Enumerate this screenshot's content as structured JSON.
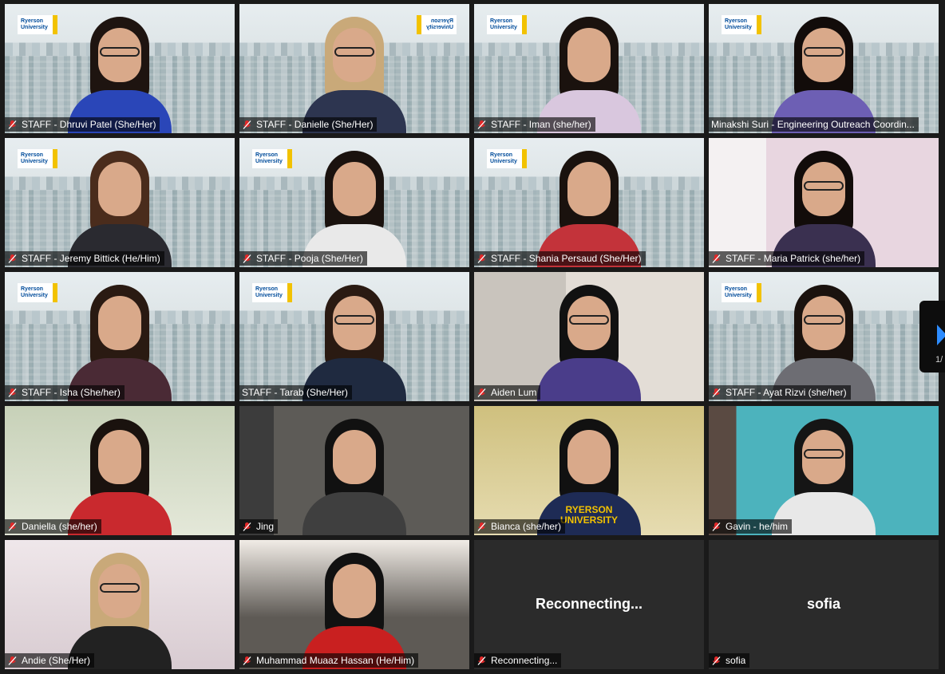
{
  "colors": {
    "active_speaker_border": "#c8e05a",
    "name_plate_bg": "rgba(0,0,0,0.62)",
    "muted_mic": "#e02828",
    "pager_arrow": "#2d8cff"
  },
  "pager": {
    "count": "1/"
  },
  "tiles": [
    {
      "name": "STAFF - Dhruvi Patel (She/Her)",
      "muted": true,
      "video": true,
      "bg": "city",
      "logo": "Ryerson University"
    },
    {
      "name": "STAFF - Danielle (She/Her)",
      "muted": true,
      "video": true,
      "bg": "city",
      "logo": "Ryerson University",
      "logo_mirrored": true
    },
    {
      "name": "STAFF - Iman (she/her)",
      "muted": true,
      "video": true,
      "bg": "city",
      "logo": "Ryerson University"
    },
    {
      "name": "Minakshi Suri - Engineering Outreach Coordin...",
      "muted": false,
      "video": true,
      "bg": "city",
      "logo": "Ryerson University",
      "active": true
    },
    {
      "name": "STAFF - Jeremy Bittick (He/Him)",
      "muted": true,
      "video": true,
      "bg": "city",
      "logo": "Ryerson University"
    },
    {
      "name": "STAFF - Pooja (She/Her)",
      "muted": true,
      "video": true,
      "bg": "city",
      "logo": "Ryerson University"
    },
    {
      "name": "STAFF - Shania Persaud (She/Her)",
      "muted": true,
      "video": true,
      "bg": "city",
      "logo": "Ryerson University"
    },
    {
      "name": "STAFF - Maria Patrick (she/her)",
      "muted": true,
      "video": true,
      "bg": "pink"
    },
    {
      "name": "STAFF - Isha (She/her)",
      "muted": true,
      "video": true,
      "bg": "city",
      "logo": "Ryerson University"
    },
    {
      "name": "STAFF - Tarab (She/Her)",
      "muted": false,
      "video": true,
      "bg": "city",
      "logo": "Ryerson University"
    },
    {
      "name": "Aiden Lum",
      "muted": true,
      "video": true,
      "bg": "shelf"
    },
    {
      "name": "STAFF - Ayat Rizvi (she/her)",
      "muted": true,
      "video": true,
      "bg": "city",
      "logo": "Ryerson University"
    },
    {
      "name": "Daniella (she/her)",
      "muted": true,
      "video": true,
      "bg": "green"
    },
    {
      "name": "Jing",
      "muted": true,
      "video": true,
      "bg": "grey"
    },
    {
      "name": "Bianca (she/her)",
      "muted": true,
      "video": true,
      "bg": "yellow",
      "shirt_text": "RYERSON UNIVERSITY"
    },
    {
      "name": "Gavin - he/him",
      "muted": true,
      "video": true,
      "bg": "teal"
    },
    {
      "name": "Andie (She/Her)",
      "muted": true,
      "video": true,
      "bg": "bedroom"
    },
    {
      "name": "Muhammad Muaaz Hassan (He/Him)",
      "muted": true,
      "video": true,
      "bg": "couch"
    },
    {
      "name": "Reconnecting...",
      "muted": true,
      "video": false,
      "center_text": "Reconnecting..."
    },
    {
      "name": "sofia",
      "muted": true,
      "video": false,
      "center_text": "sofia"
    }
  ]
}
